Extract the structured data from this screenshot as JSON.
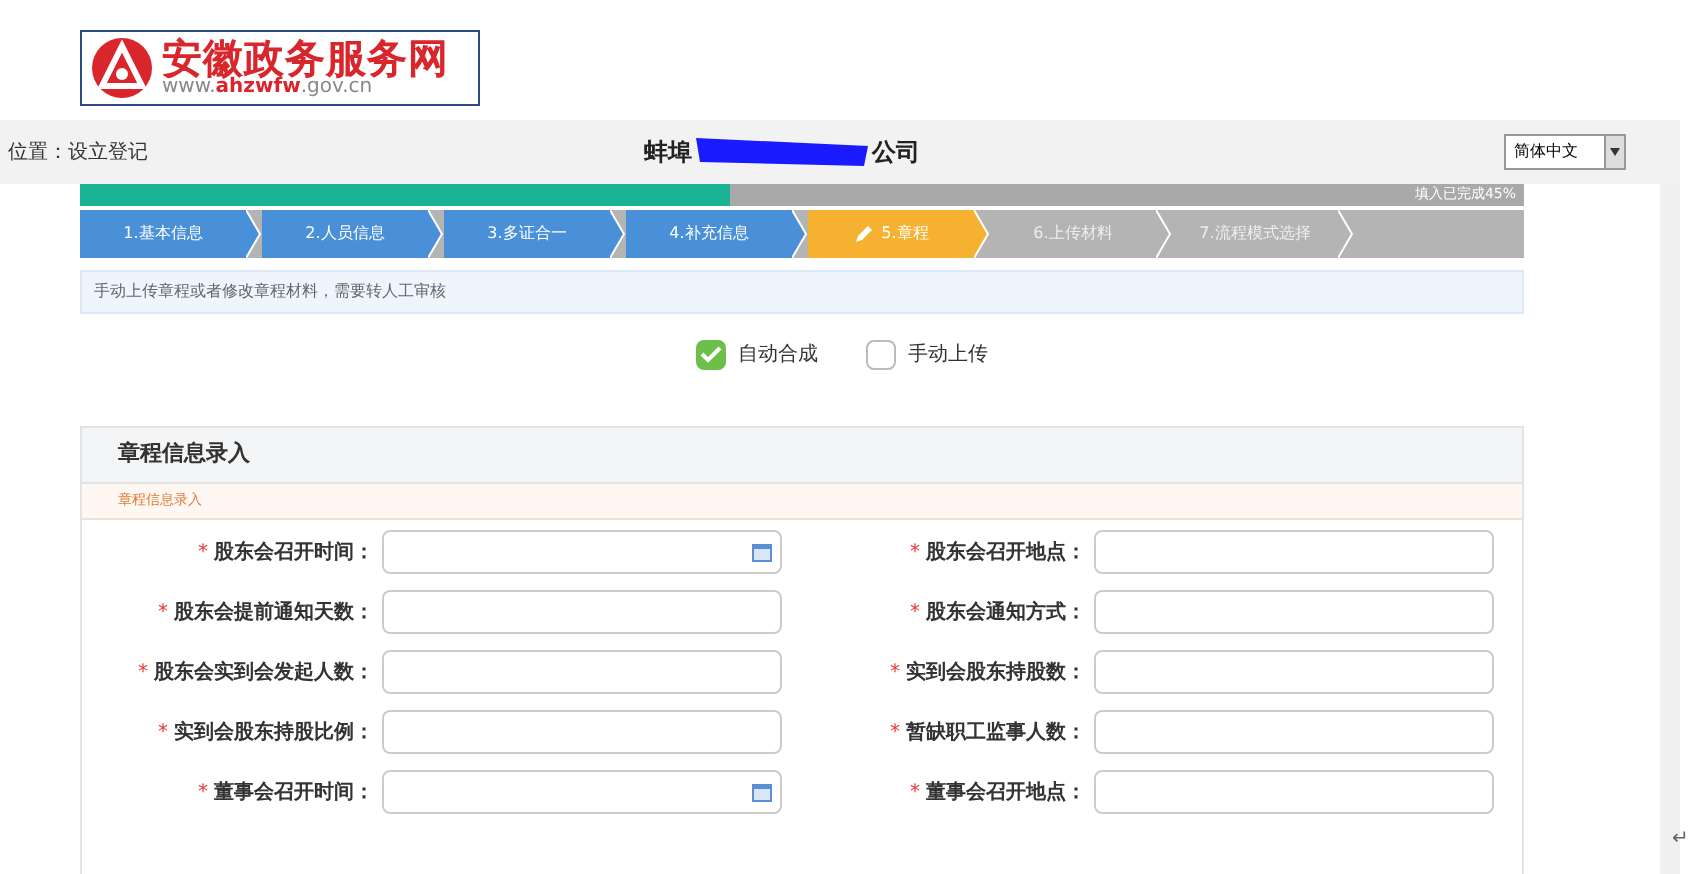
{
  "logo": {
    "title": "安徽政务服务网",
    "url_prefix": "www.",
    "url_bold": "ahzwfw",
    "url_suffix": ".gov.cn"
  },
  "header": {
    "location": "位置：设立登记",
    "title_start": "蚌埠",
    "title_end": "公司",
    "language": "简体中文"
  },
  "progress": {
    "level": 0.45,
    "label": "填入已完成45%"
  },
  "steps": [
    {
      "label": "1.基本信息",
      "kind": "done"
    },
    {
      "label": "2.人员信息",
      "kind": "done"
    },
    {
      "label": "3.多证合一",
      "kind": "done"
    },
    {
      "label": "4.补充信息",
      "kind": "done"
    },
    {
      "label": "5.章程",
      "kind": "current"
    },
    {
      "label": "6.上传材料",
      "kind": "pending"
    },
    {
      "label": "7.流程模式选择",
      "kind": "pending"
    }
  ],
  "notice": "手动上传章程或者修改章程材料，需要转人工审核",
  "options": [
    {
      "label": "自动合成",
      "checked": true
    },
    {
      "label": "手动上传",
      "checked": false
    }
  ],
  "card": {
    "title": "章程信息录入",
    "subtitle": "章程信息录入",
    "fields": [
      {
        "mark": "*",
        "label": "股东会召开时间：",
        "kind": "date"
      },
      {
        "mark": "*",
        "label": "股东会召开地点：",
        "kind": "text"
      },
      {
        "mark": "*",
        "label": "股东会提前通知天数：",
        "kind": "text"
      },
      {
        "mark": "*",
        "label": "股东会通知方式：",
        "kind": "text"
      },
      {
        "mark": "*",
        "label": "股东会实到会发起人数：",
        "kind": "text"
      },
      {
        "mark": "*",
        "label": "实到会股东持股数：",
        "kind": "text"
      },
      {
        "mark": "*",
        "label": "实到会股东持股比例：",
        "kind": "text"
      },
      {
        "mark": "*",
        "label": "暂缺职工监事人数：",
        "kind": "text"
      },
      {
        "mark": "*",
        "label": "董事会召开时间：",
        "kind": "date"
      },
      {
        "mark": "*",
        "label": "董事会召开地点：",
        "kind": "text"
      }
    ]
  },
  "return_mark": "↵"
}
